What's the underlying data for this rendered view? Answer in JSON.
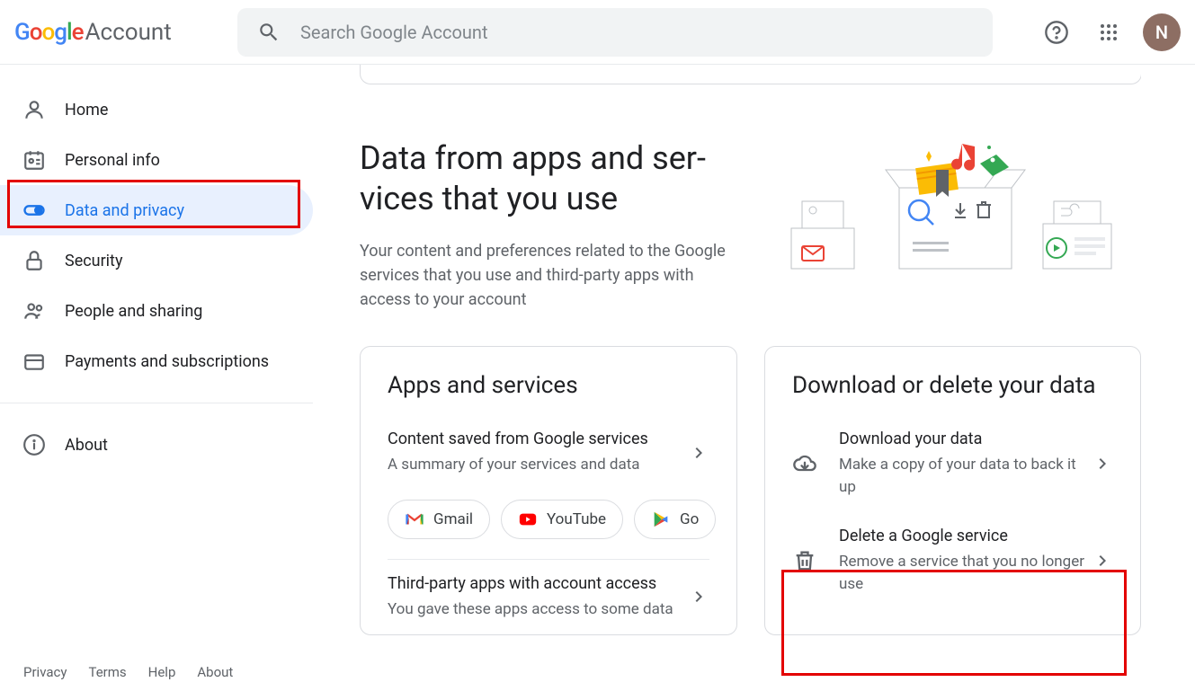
{
  "header": {
    "logo_account": "Account",
    "search_placeholder": "Search Google Account",
    "avatar_letter": "N"
  },
  "sidebar": {
    "items": [
      {
        "label": "Home"
      },
      {
        "label": "Personal info"
      },
      {
        "label": "Data and privacy"
      },
      {
        "label": "Security"
      },
      {
        "label": "People and sharing"
      },
      {
        "label": "Payments and subscriptions"
      }
    ],
    "about": "About"
  },
  "footer": {
    "privacy": "Privacy",
    "terms": "Terms",
    "help": "Help",
    "about": "About"
  },
  "main": {
    "section_title": "Data from apps and ser­vices that you use",
    "section_subtitle": "Your content and preferences related to the Google services that you use and third-party apps with access to your account",
    "card_left": {
      "title": "Apps and services",
      "item1_title": "Content saved from Google services",
      "item1_sub": "A summary of your services and data",
      "chips": {
        "gmail": "Gmail",
        "youtube": "YouTube",
        "play": "Go"
      },
      "item2_title": "Third-party apps with account access",
      "item2_sub": "You gave these apps access to some data"
    },
    "card_right": {
      "title": "Download or delete your data",
      "item1_title": "Download your data",
      "item1_sub": "Make a copy of your data to back it up",
      "item2_title": "Delete a Google service",
      "item2_sub": "Remove a service that you no longer use"
    }
  }
}
